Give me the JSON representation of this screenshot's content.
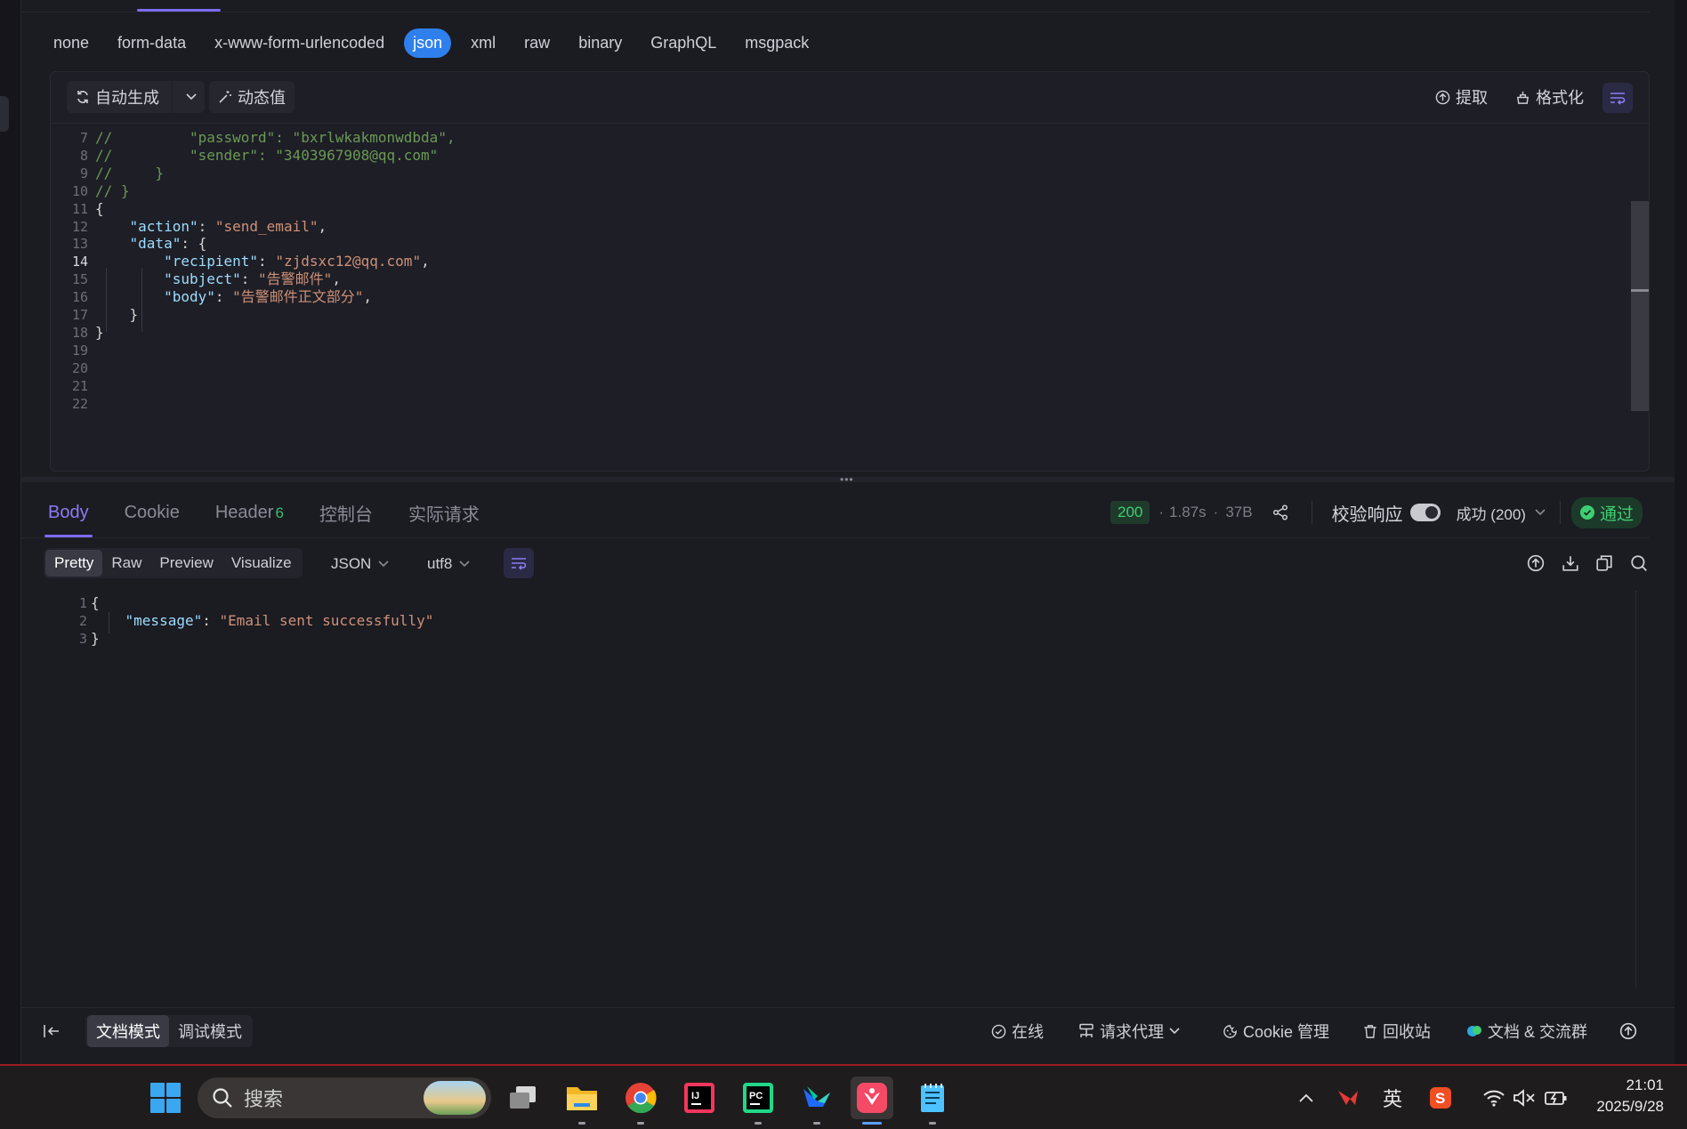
{
  "body_types": [
    "none",
    "form-data",
    "x-www-form-urlencoded",
    "json",
    "xml",
    "raw",
    "binary",
    "GraphQL",
    "msgpack"
  ],
  "body_type_active": "json",
  "editor_toolbar": {
    "auto_generate": "自动生成",
    "dynamic_value": "动态值",
    "extract": "提取",
    "format": "格式化"
  },
  "request_code": [
    {
      "n": "7",
      "t": "//         \"password\": \"bxrlwkakmonwdbda\","
    },
    {
      "n": "8",
      "t": "//         \"sender\": \"3403967908@qq.com\""
    },
    {
      "n": "9",
      "t": "//     }"
    },
    {
      "n": "10",
      "t": "// }"
    },
    {
      "n": "11",
      "t": "{"
    },
    {
      "n": "12",
      "t": "    \"action\": \"send_email\","
    },
    {
      "n": "13",
      "t": "    \"data\": {"
    },
    {
      "n": "14",
      "t": "        \"recipient\": \"zjdsxc12@qq.com\","
    },
    {
      "n": "15",
      "t": "        \"subject\": \"告警邮件\","
    },
    {
      "n": "16",
      "t": "        \"body\": \"告警邮件正文部分\","
    },
    {
      "n": "17",
      "t": "    }"
    },
    {
      "n": "18",
      "t": "}"
    },
    {
      "n": "19",
      "t": ""
    },
    {
      "n": "20",
      "t": ""
    },
    {
      "n": "21",
      "t": ""
    },
    {
      "n": "22",
      "t": ""
    }
  ],
  "current_line": "14",
  "response_tabs": {
    "body": "Body",
    "cookie": "Cookie",
    "header": "Header",
    "header_count": "6",
    "console": "控制台",
    "actual_request": "实际请求"
  },
  "response_meta": {
    "status": "200",
    "time": "1.87s",
    "size": "37B",
    "validate_label": "校验响应",
    "result_select": "成功 (200)",
    "pass_label": "通过"
  },
  "view_modes": [
    "Pretty",
    "Raw",
    "Preview",
    "Visualize"
  ],
  "view_mode_active": "Pretty",
  "format_select": "JSON",
  "encoding_select": "utf8",
  "response_code": [
    {
      "n": "1",
      "t": "{"
    },
    {
      "n": "2",
      "t": "    \"message\": \"Email sent successfully\""
    },
    {
      "n": "3",
      "t": "}"
    }
  ],
  "statusbar": {
    "doc_mode": "文档模式",
    "debug_mode": "调试模式",
    "online": "在线",
    "proxy": "请求代理",
    "cookie_mgmt": "Cookie 管理",
    "recycle": "回收站",
    "docs_group": "文档 & 交流群"
  },
  "taskbar": {
    "search_placeholder": "搜索",
    "ime": "英",
    "time": "21:01",
    "date": "2025/9/28"
  },
  "colors": {
    "accent": "#7b6cf0",
    "json_active": "#2f80ed",
    "success": "#3fcf73",
    "comment": "#6a9955",
    "key": "#9cdcfe",
    "string": "#ce9178"
  }
}
